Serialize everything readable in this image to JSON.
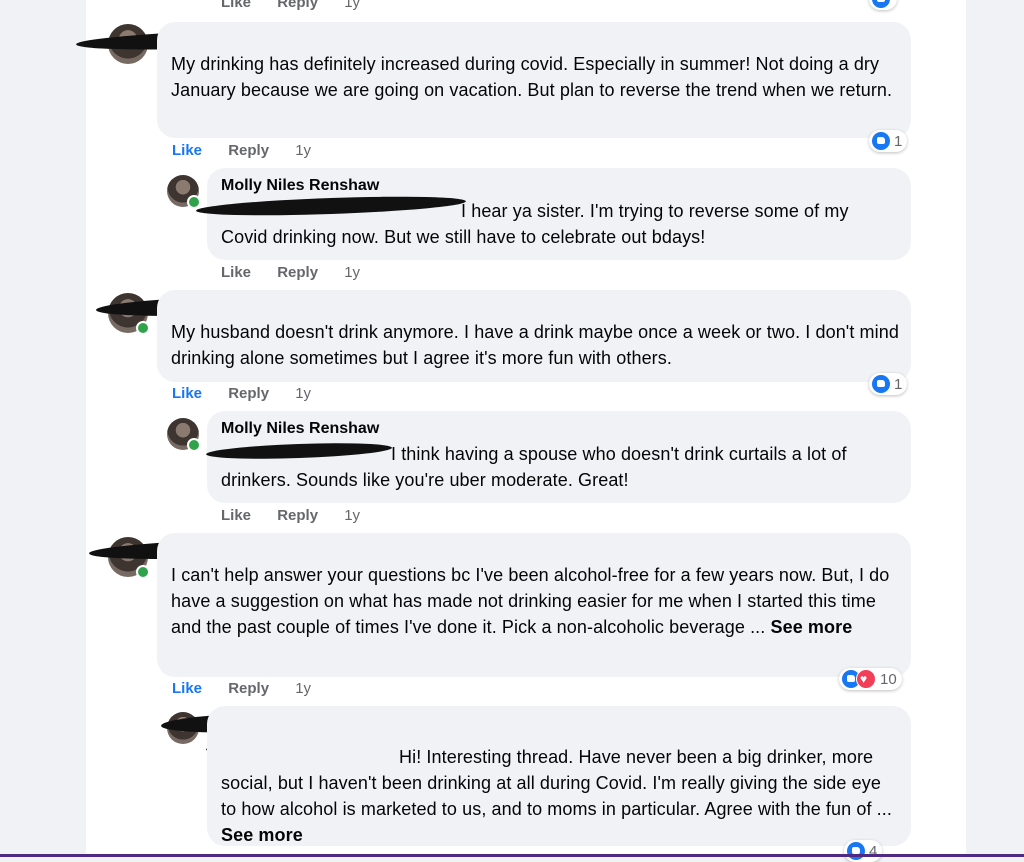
{
  "labels": {
    "like": "Like",
    "reply": "Reply",
    "time": "1y",
    "see_more": "See more"
  },
  "comments": [
    {
      "text": "My drinking has definitely increased during covid. Especially in summer! Not doing a dry January because we are going on vacation. But plan to reverse the trend when we return.",
      "reactions": "1"
    },
    {
      "author": "Molly Niles Renshaw",
      "text": "I hear ya sister. I'm trying to reverse some of my Covid drinking now. But we still have to celebrate out bdays!"
    },
    {
      "text": "My husband doesn't drink anymore. I have a drink maybe once a week or two. I don't mind drinking alone sometimes but I agree it's more fun with others.",
      "reactions": "1"
    },
    {
      "author": "Molly Niles Renshaw",
      "text": "I think having a spouse who doesn't drink curtails a lot of drinkers. Sounds like you're uber moderate. Great!"
    },
    {
      "text": "I can't help answer your questions bc I've been alcohol-free for a few years now. But, I do have a suggestion on what has made not drinking easier for me when I started this time and the past couple of times I've done it. Pick a non-alcoholic beverage ...",
      "reactions": "10"
    },
    {
      "text": "Hi! Interesting thread. Have never been a big drinker, more social, but I haven't been drinking at all during Covid. I'm really giving the side eye to how alcohol is marketed to us, and to moms in particular. Agree with the fun of ...",
      "reactions": "4"
    }
  ]
}
